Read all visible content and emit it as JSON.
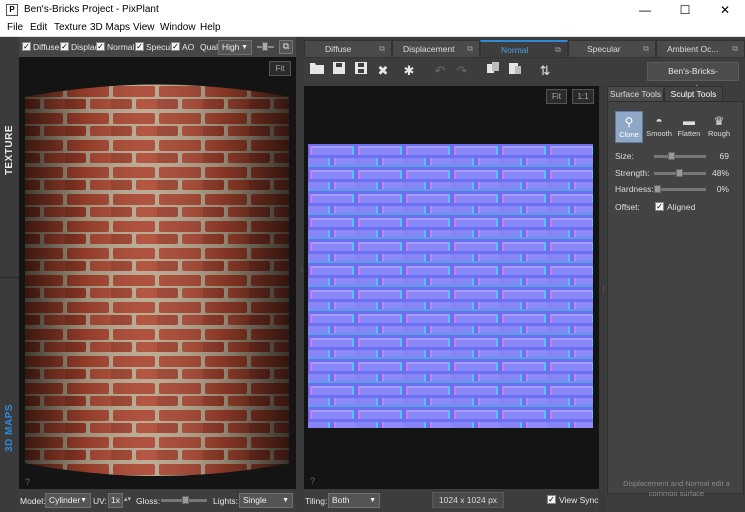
{
  "window": {
    "title": "Ben's-Bricks Project - PixPlant",
    "app_icon": "P",
    "controls": [
      "—",
      "☐",
      "✕"
    ]
  },
  "menubar": [
    "File",
    "Edit",
    "Texture",
    "3D Maps",
    "View",
    "Window",
    "Help"
  ],
  "side_tabs": {
    "texture": "TEXTURE",
    "maps": "3D MAPS"
  },
  "left_toolbar": {
    "checks": [
      {
        "label": "Diffuse",
        "checked": true
      },
      {
        "label": "Displac",
        "checked": true
      },
      {
        "label": "Normal",
        "checked": true
      },
      {
        "label": "Specul",
        "checked": true
      },
      {
        "label": "AO",
        "checked": true
      }
    ],
    "quality_label": "Qual",
    "quality_value": "High"
  },
  "viewport3d": {
    "fit": "Fit",
    "help": "?"
  },
  "left_bottom": {
    "model_label": "Model:",
    "model_value": "Cylinder",
    "uv_label": "UV:",
    "uv_value": "1x",
    "gloss_label": "Gloss:",
    "gloss_level": 0.55,
    "lights_label": "Lights:",
    "lights_value": "Single"
  },
  "tabs": [
    {
      "label": "Diffuse",
      "active": false
    },
    {
      "label": "Displacement",
      "active": false
    },
    {
      "label": "Normal",
      "active": true
    },
    {
      "label": "Specular",
      "active": false
    },
    {
      "label": "Ambient Oc...",
      "active": false
    }
  ],
  "toolbar": {
    "icons": [
      "open-icon",
      "save-icon",
      "save-as-icon",
      "close-icon",
      "gear-icon",
      "undo-icon",
      "redo-icon",
      "copy-icon",
      "paste-icon",
      "swap-icon"
    ],
    "filename": "Ben's-Bricks-normal.png"
  },
  "normal_view": {
    "fit": "Fit",
    "one_to_one": "1:1",
    "help": "?"
  },
  "bottom_bar": {
    "tiling_label": "Tiling:",
    "tiling_value": "Both",
    "size": "1024 x 1024 px",
    "view_sync_label": "View Sync",
    "view_sync": true
  },
  "right_panel": {
    "tabs": [
      {
        "label": "Surface Tools",
        "active": false
      },
      {
        "label": "Sculpt Tools",
        "active": true
      }
    ],
    "tools": [
      {
        "label": "Clone",
        "selected": true
      },
      {
        "label": "Smooth",
        "selected": false
      },
      {
        "label": "Flatten",
        "selected": false
      },
      {
        "label": "Rough",
        "selected": false
      }
    ],
    "sliders": [
      {
        "label": "Size:",
        "value": "69",
        "level": 0.31
      },
      {
        "label": "Strength:",
        "value": "48%",
        "level": 0.48
      },
      {
        "label": "Hardness:",
        "value": "0%",
        "level": 0.0
      }
    ],
    "offset_label": "Offset:",
    "aligned_label": "Aligned",
    "aligned": true,
    "note_line1": "Displacement and Normal edit a",
    "note_line2": "common surface"
  },
  "colors": {
    "accent": "#2d89d8",
    "brick": "#a8442e",
    "mortar": "#b9a890",
    "normal_base": "#8484f4"
  }
}
